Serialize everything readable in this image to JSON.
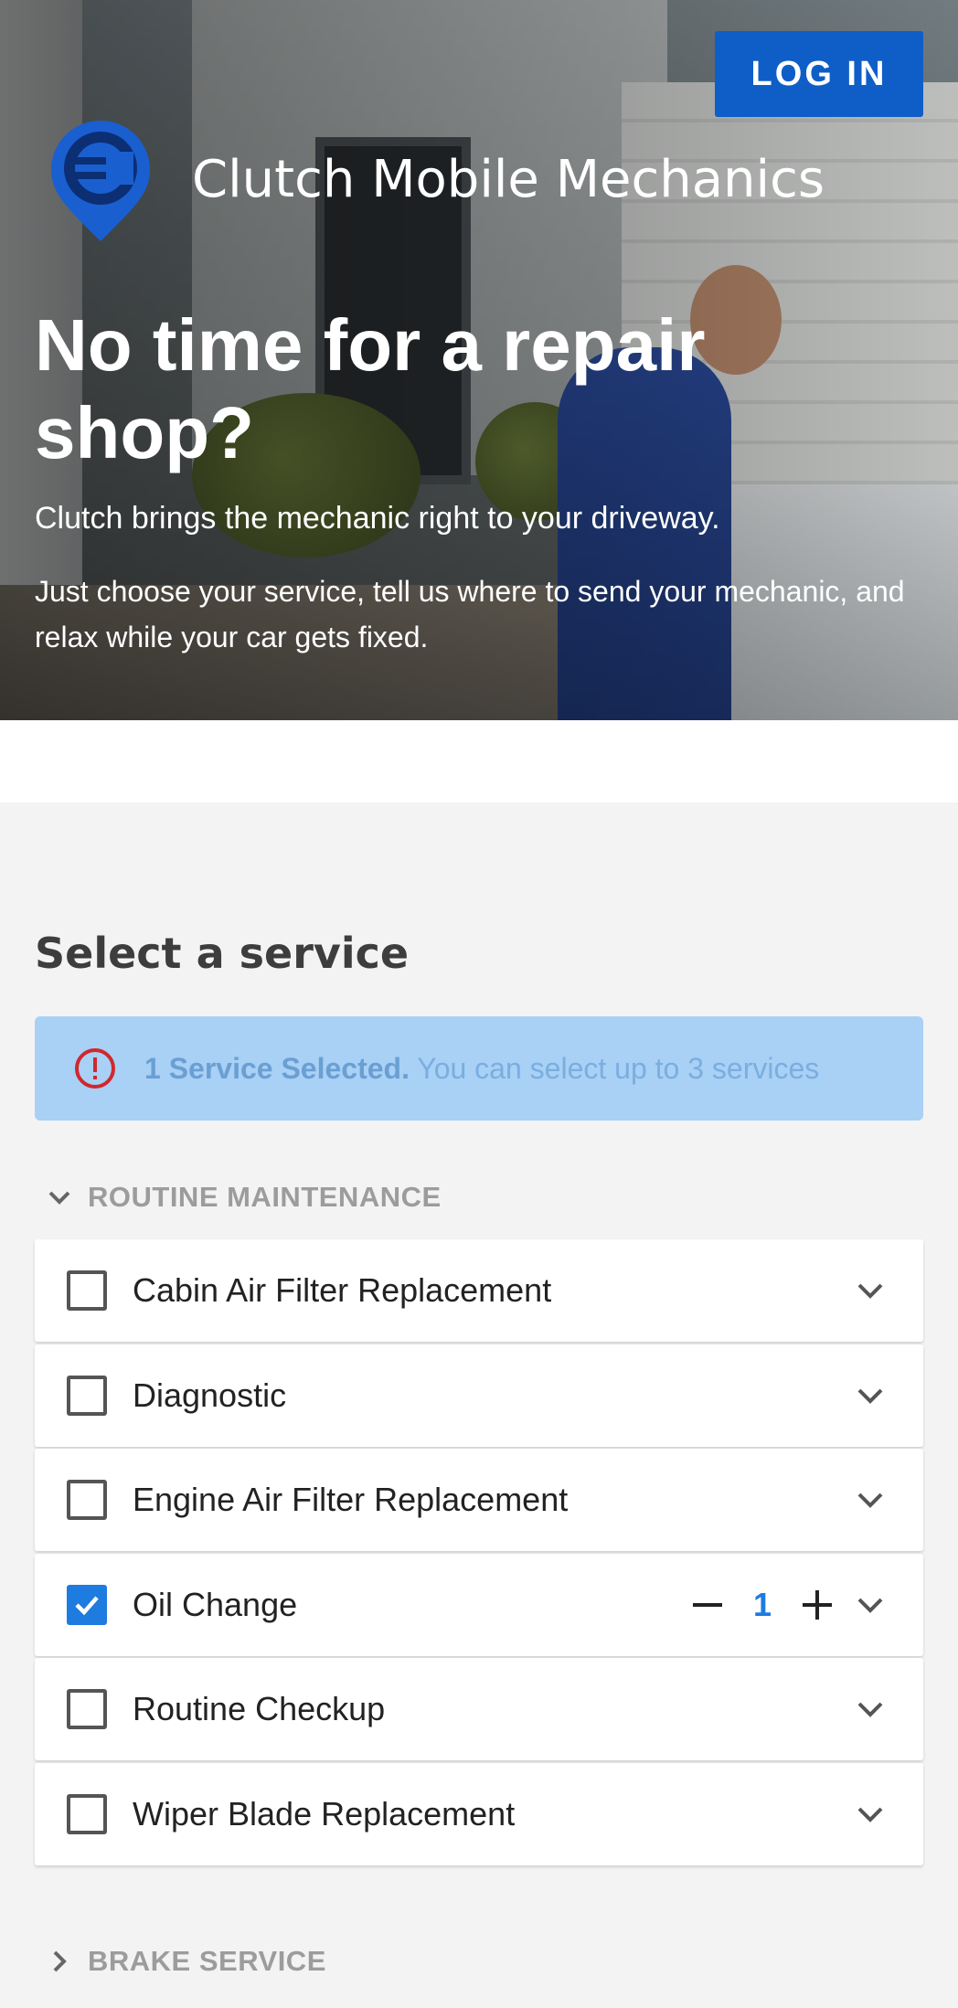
{
  "header": {
    "login_label": "LOG IN",
    "brand_name": "Clutch Mobile Mechanics"
  },
  "hero": {
    "headline": "No time for a repair shop?",
    "subhead": "Clutch brings the mechanic right to your driveway.",
    "body": "Just choose your service, tell us where to send your mechanic, and relax while your car gets fixed."
  },
  "services": {
    "title": "Select a service",
    "alert": {
      "icon": "alert-circle-icon",
      "bold": "1 Service Selected.",
      "text": " You can select up to 3 services"
    },
    "categories": [
      {
        "label": "ROUTINE MAINTENANCE",
        "expanded": true,
        "items": [
          {
            "label": "Cabin Air Filter Replacement",
            "checked": false
          },
          {
            "label": "Diagnostic",
            "checked": false
          },
          {
            "label": "Engine Air Filter Replacement",
            "checked": false
          },
          {
            "label": "Oil Change",
            "checked": true,
            "quantity": "1"
          },
          {
            "label": "Routine Checkup",
            "checked": false
          },
          {
            "label": "Wiper Blade Replacement",
            "checked": false
          }
        ]
      },
      {
        "label": "BRAKE SERVICE",
        "expanded": false
      }
    ]
  },
  "colors": {
    "primary": "#0f5ec7",
    "accent": "#1e7be0",
    "alert_bg": "#a9d0f5",
    "alert_icon": "#d0282e"
  }
}
